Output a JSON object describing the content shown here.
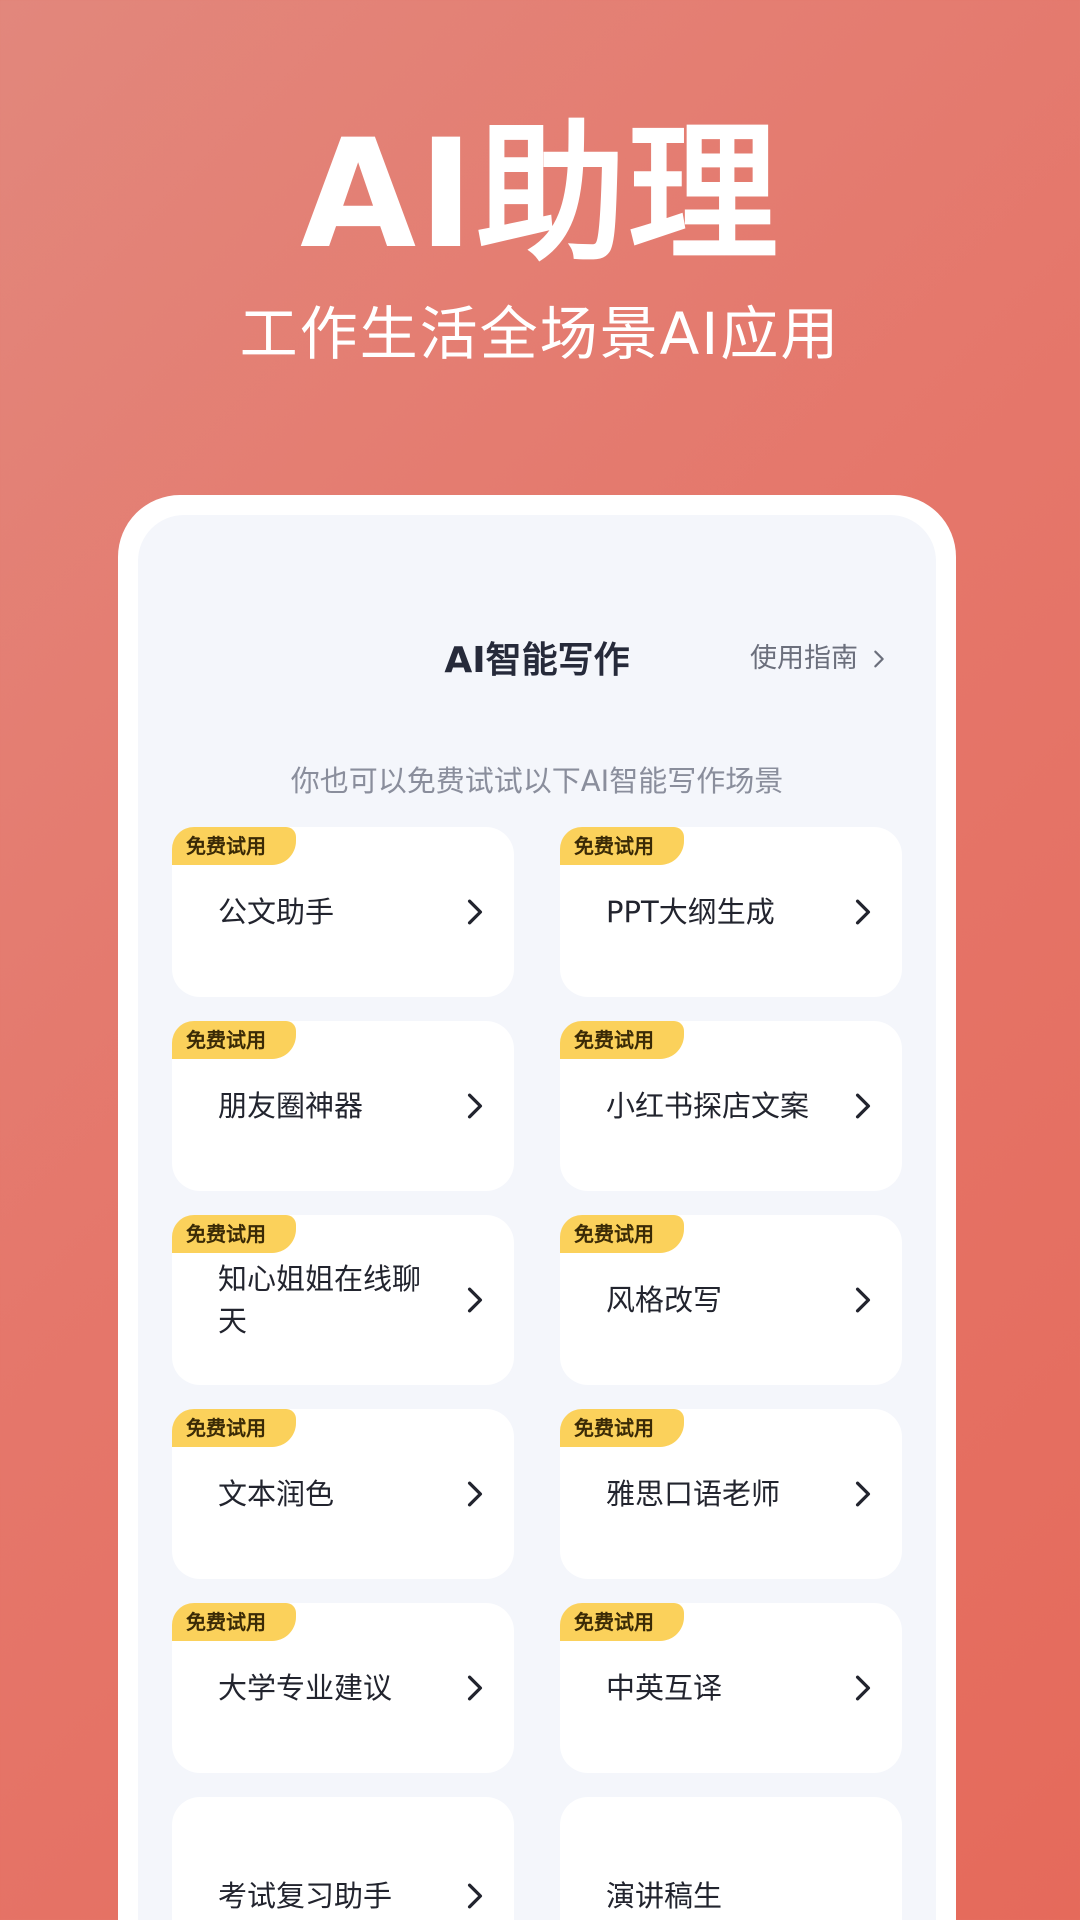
{
  "hero": {
    "title": "AI助理",
    "subtitle": "工作生活全场景AI应用"
  },
  "screen": {
    "title": "AI智能写作",
    "guide_label": "使用指南",
    "hint": "你也可以免费试试以下AI智能写作场景"
  },
  "badge_label": "免费试用",
  "cards": [
    {
      "label": "公文助手",
      "badge": "免费试用"
    },
    {
      "label": "PPT大纲生成",
      "badge": "免费试用"
    },
    {
      "label": "朋友圈神器",
      "badge": "免费试用"
    },
    {
      "label": "小红书探店文案",
      "badge": "免费试用"
    },
    {
      "label": "知心姐姐在线聊天",
      "badge": "免费试用"
    },
    {
      "label": "风格改写",
      "badge": "免费试用"
    },
    {
      "label": "文本润色",
      "badge": "免费试用"
    },
    {
      "label": "雅思口语老师",
      "badge": "免费试用"
    },
    {
      "label": "大学专业建议",
      "badge": "免费试用"
    },
    {
      "label": "中英互译",
      "badge": "免费试用"
    },
    {
      "label": "考试复习助手"
    },
    {
      "label": "演讲稿生"
    }
  ],
  "colors": {
    "background_start": "#e2877c",
    "background_end": "#e56a5b",
    "badge": "#fbd15b",
    "screen_bg": "#f4f6fb",
    "text_primary": "#22242e"
  },
  "icons": {
    "card_arrow": "chevron-right-icon",
    "guide_arrow": "chevron-right-icon"
  }
}
